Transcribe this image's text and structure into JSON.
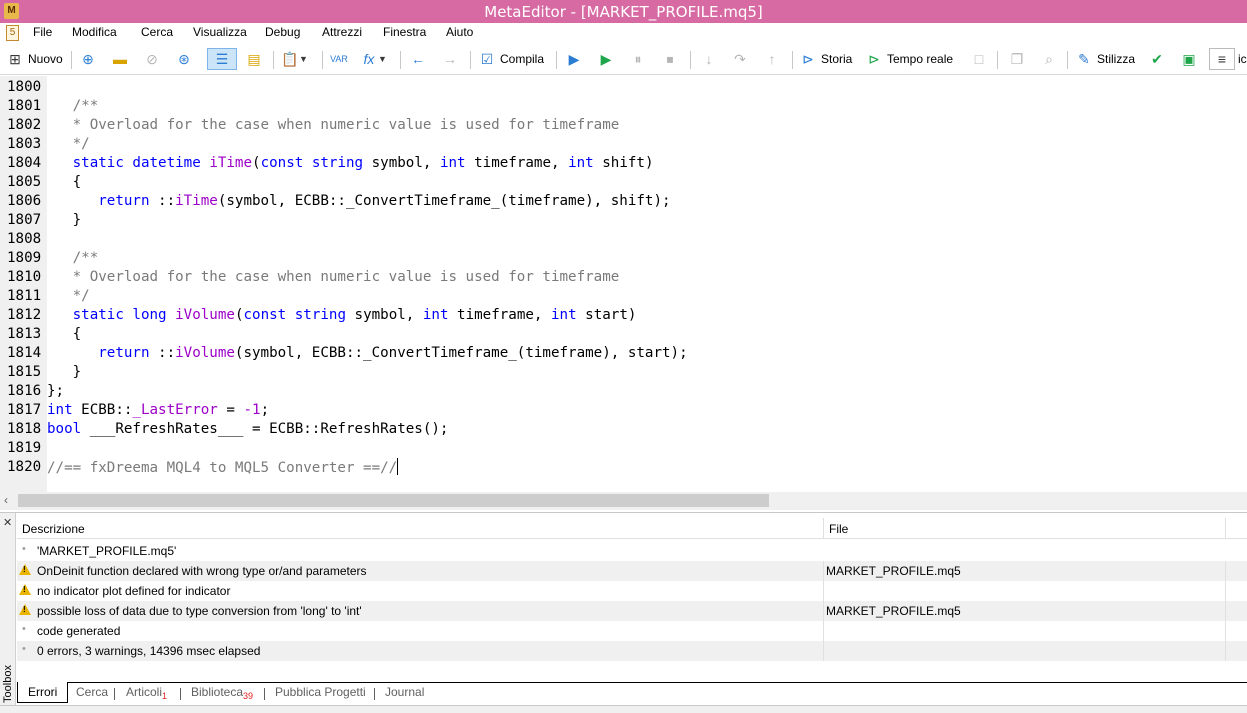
{
  "window": {
    "title": "MetaEditor - [MARKET_PROFILE.mq5]",
    "app_icon": "metaeditor-icon",
    "doc_icon": "mq5-document-icon",
    "doc_icon_glyph": "5"
  },
  "menu": [
    "File",
    "Modifica",
    "Cerca",
    "Visualizza",
    "Debug",
    "Attrezzi",
    "Finestra",
    "Aiuto"
  ],
  "toolbar": {
    "new_label": "Nuovo",
    "compile_label": "Compila",
    "history_label": "Storia",
    "realtime_label": "Tempo reale",
    "styler_label": "Stilizza",
    "overflow_label": "ic"
  },
  "editor": {
    "lines": [
      {
        "n": "1800",
        "html": ""
      },
      {
        "n": "1801",
        "html": "   <span class=\"cm\">/**</span>"
      },
      {
        "n": "1802",
        "html": "   <span class=\"cm\">* Overload for the case when numeric value is used for timeframe</span>"
      },
      {
        "n": "1803",
        "html": "   <span class=\"cm\">*/</span>"
      },
      {
        "n": "1804",
        "html": "   <span class=\"kw\">static</span> <span class=\"kw\">datetime</span> <span class=\"fn\">iTime</span>(<span class=\"kw\">const</span> <span class=\"kw\">string</span> symbol, <span class=\"kw\">int</span> timeframe, <span class=\"kw\">int</span> shift)"
      },
      {
        "n": "1805",
        "html": "   {"
      },
      {
        "n": "1806",
        "html": "      <span class=\"kw\">return</span> ::<span class=\"fn\">iTime</span>(symbol, ECBB::_ConvertTimeframe_(timeframe), shift);"
      },
      {
        "n": "1807",
        "html": "   }"
      },
      {
        "n": "1808",
        "html": ""
      },
      {
        "n": "1809",
        "html": "   <span class=\"cm\">/**</span>"
      },
      {
        "n": "1810",
        "html": "   <span class=\"cm\">* Overload for the case when numeric value is used for timeframe</span>"
      },
      {
        "n": "1811",
        "html": "   <span class=\"cm\">*/</span>"
      },
      {
        "n": "1812",
        "html": "   <span class=\"kw\">static</span> <span class=\"kw\">long</span> <span class=\"fn\">iVolume</span>(<span class=\"kw\">const</span> <span class=\"kw\">string</span> symbol, <span class=\"kw\">int</span> timeframe, <span class=\"kw\">int</span> start)"
      },
      {
        "n": "1813",
        "html": "   {"
      },
      {
        "n": "1814",
        "html": "      <span class=\"kw\">return</span> ::<span class=\"fn\">iVolume</span>(symbol, ECBB::_ConvertTimeframe_(timeframe), start);"
      },
      {
        "n": "1815",
        "html": "   }"
      },
      {
        "n": "1816",
        "html": "};"
      },
      {
        "n": "1817",
        "html": "<span class=\"kw\">int</span> ECBB::<span class=\"fn\">_LastError</span> = <span class=\"num\">-1</span>;"
      },
      {
        "n": "1818",
        "html": "<span class=\"kw\">bool</span> ___RefreshRates___ = ECBB::RefreshRates();"
      },
      {
        "n": "1819",
        "html": ""
      },
      {
        "n": "1820",
        "html": "<span class=\"cm\">//== fxDreema MQL4 to MQL5 Converter ==//</span><span class=\"cursor\"></span>"
      }
    ]
  },
  "toolbox": {
    "side_label": "Toolbox",
    "close_glyph": "✕",
    "col_description": "Descrizione",
    "col_file": "File",
    "rows": [
      {
        "type": "info",
        "desc": "'MARKET_PROFILE.mq5'",
        "file": ""
      },
      {
        "type": "warning",
        "desc": "OnDeinit function declared with wrong type or/and parameters",
        "file": "MARKET_PROFILE.mq5"
      },
      {
        "type": "warning",
        "desc": "no indicator plot defined for indicator",
        "file": ""
      },
      {
        "type": "warning",
        "desc": "possible loss of data due to type conversion from 'long' to 'int'",
        "file": "MARKET_PROFILE.mq5"
      },
      {
        "type": "info",
        "desc": "code generated",
        "file": ""
      },
      {
        "type": "info",
        "desc": "0 errors, 3 warnings, 14396 msec elapsed",
        "file": ""
      }
    ],
    "tabs": [
      {
        "label": "Errori",
        "badge": ""
      },
      {
        "label": "Cerca",
        "badge": ""
      },
      {
        "label": "Articoli",
        "badge": "1"
      },
      {
        "label": "Biblioteca",
        "badge": "39"
      },
      {
        "label": "Pubblica Progetti",
        "badge": ""
      },
      {
        "label": "Journal",
        "badge": ""
      }
    ]
  }
}
